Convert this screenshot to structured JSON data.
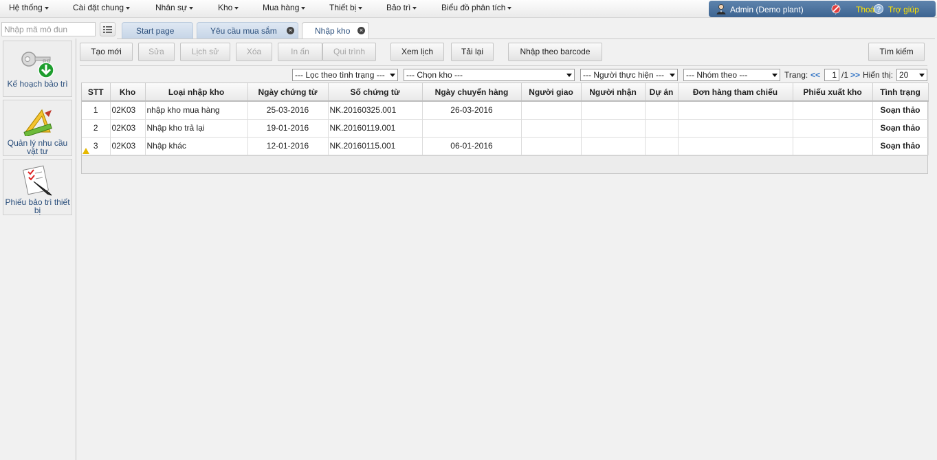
{
  "menu": {
    "items": [
      {
        "label": "Hệ thống"
      },
      {
        "label": "Cài đặt chung"
      },
      {
        "label": "Nhân sự"
      },
      {
        "label": "Kho"
      },
      {
        "label": "Mua hàng"
      },
      {
        "label": "Thiết bị"
      },
      {
        "label": "Bảo trì"
      },
      {
        "label": "Biểu đồ phân tích"
      }
    ]
  },
  "user": {
    "name": "Admin (Demo plant)",
    "logout": "Thoát",
    "help": "Trợ giúp",
    "help_icon": "?"
  },
  "search": {
    "placeholder": "Nhập mã mô đun"
  },
  "tabs": [
    {
      "label": "Start page"
    },
    {
      "label": "Yêu cầu mua sắm"
    },
    {
      "label": "Nhập kho"
    }
  ],
  "sidebar": {
    "items": [
      {
        "label_line1": "Kế hoạch bảo trì",
        "label_line2": ""
      },
      {
        "label_line1": "Quản lý nhu cầu",
        "label_line2": "vật tư"
      },
      {
        "label_line1": "Phiếu bảo trì thiết",
        "label_line2": "bị"
      }
    ]
  },
  "toolbar": {
    "create": "Tạo mới",
    "edit": "Sửa",
    "history": "Lịch sử",
    "delete": "Xóa",
    "print": "In ấn",
    "workflow": "Qui trình",
    "calendar": "Xem lịch",
    "reload": "Tải lại",
    "barcode": "Nhập theo barcode",
    "search": "Tìm kiếm"
  },
  "filters": {
    "status": "--- Lọc theo tình trạng ---",
    "warehouse": "--- Chọn kho ---",
    "performer": "--- Người thực hiện ---",
    "group": "--- Nhóm theo ---"
  },
  "pager": {
    "page_label": "Trang:",
    "prev": "<<",
    "page": "1",
    "total": "/1",
    "next": ">>",
    "show_label": "Hiển thị:",
    "page_size": "20"
  },
  "table": {
    "columns": [
      "STT",
      "Kho",
      "Loại nhập kho",
      "Ngày chứng từ",
      "Số chứng từ",
      "Ngày chuyển hàng",
      "Người giao",
      "Người nhận",
      "Dự án",
      "Đơn hàng tham chiếu",
      "Phiếu xuất kho",
      "Tình trạng"
    ],
    "rows": [
      {
        "stt": "1",
        "kho": "02K03",
        "loai": "nhập kho mua hàng",
        "ngay_ct": "25-03-2016",
        "so_ct": "NK.20160325.001",
        "ngay_ch": "26-03-2016",
        "nguoi_giao": "",
        "nguoi_nhan": "",
        "du_an": "",
        "don_hang": "",
        "phieu_xuat": "",
        "tinh_trang": "Soạn thảo",
        "warning": false
      },
      {
        "stt": "2",
        "kho": "02K03",
        "loai": "Nhập kho trả lại",
        "ngay_ct": "19-01-2016",
        "so_ct": "NK.20160119.001",
        "ngay_ch": "",
        "nguoi_giao": "",
        "nguoi_nhan": "",
        "du_an": "",
        "don_hang": "",
        "phieu_xuat": "",
        "tinh_trang": "Soạn thảo",
        "warning": false
      },
      {
        "stt": "3",
        "kho": "02K03",
        "loai": "Nhập khác",
        "ngay_ct": "12-01-2016",
        "so_ct": "NK.20160115.001",
        "ngay_ch": "06-01-2016",
        "nguoi_giao": "",
        "nguoi_nhan": "",
        "du_an": "",
        "don_hang": "",
        "phieu_xuat": "",
        "tinh_trang": "Soạn thảo",
        "warning": true
      }
    ]
  },
  "colors": {
    "accent": "#3d6491",
    "link": "#2b6fc3",
    "warning": "#e6b800"
  }
}
